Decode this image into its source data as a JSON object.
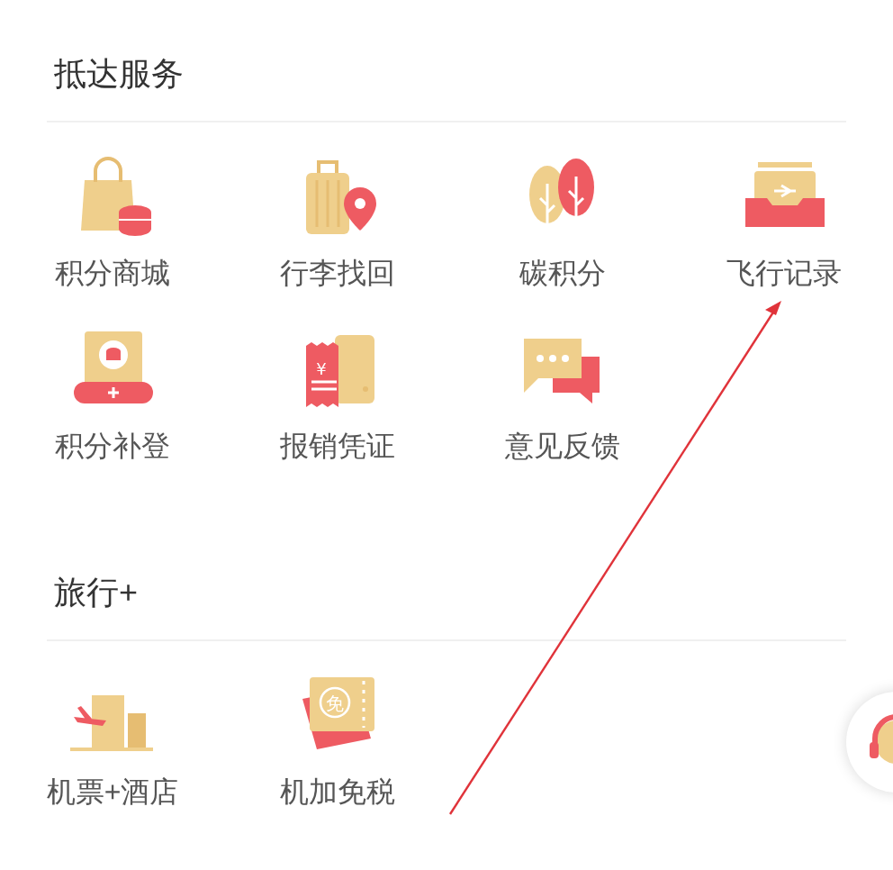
{
  "sections": [
    {
      "title": "抵达服务",
      "items": [
        {
          "label": "积分商城"
        },
        {
          "label": "行李找回"
        },
        {
          "label": "碳积分"
        },
        {
          "label": "飞行记录"
        },
        {
          "label": "积分补登"
        },
        {
          "label": "报销凭证",
          "badge": "¥"
        },
        {
          "label": "意见反馈"
        }
      ]
    },
    {
      "title": "旅行+",
      "items": [
        {
          "label": "机票+酒店"
        },
        {
          "label": "机加免税",
          "badge": "免"
        }
      ]
    }
  ]
}
